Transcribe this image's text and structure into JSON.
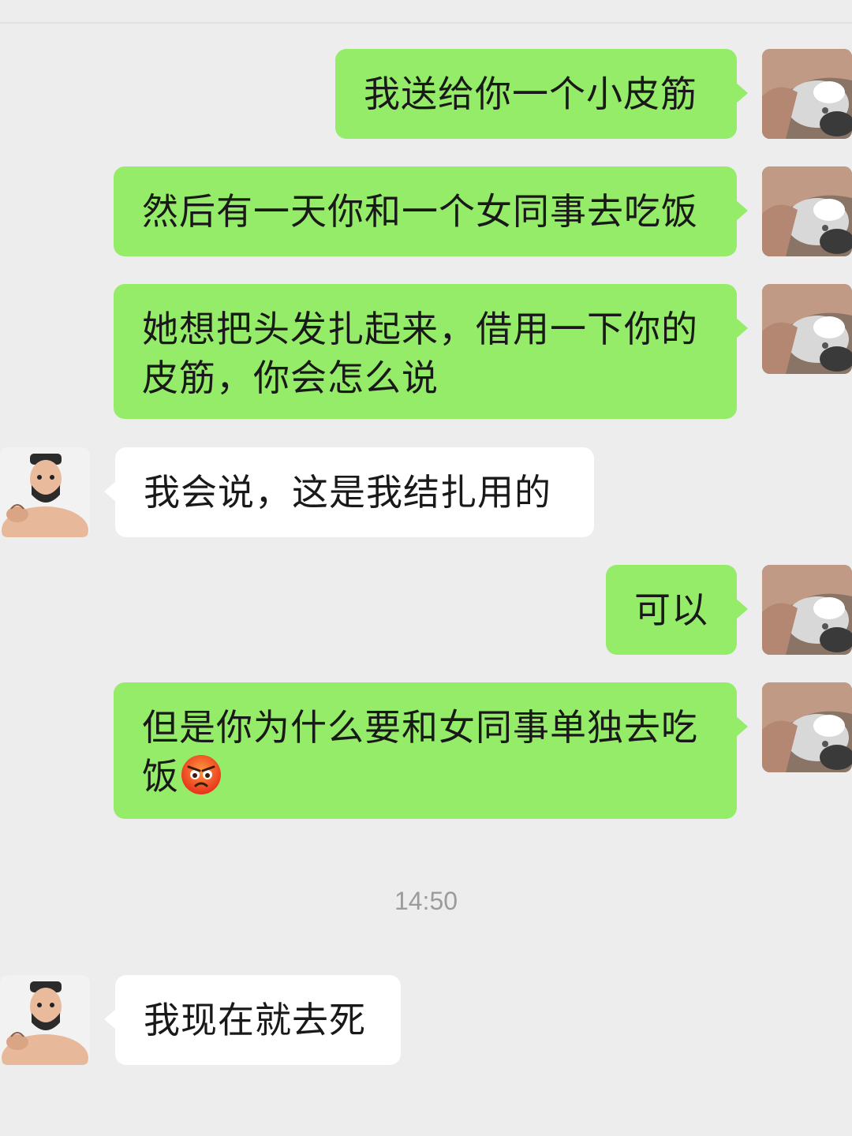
{
  "chat": {
    "messages": [
      {
        "sender": "me",
        "text": "我送给你一个小皮筋",
        "avatar": "cat-photo-avatar"
      },
      {
        "sender": "me",
        "text": "然后有一天你和一个女同事去吃饭",
        "avatar": "cat-photo-avatar"
      },
      {
        "sender": "me",
        "text": "她想把头发扎起来，借用一下你的皮筋，你会怎么说",
        "avatar": "cat-photo-avatar"
      },
      {
        "sender": "other",
        "text": "我会说，这是我结扎用的",
        "avatar": "cartoon-man-avatar"
      },
      {
        "sender": "me",
        "text": "可以",
        "avatar": "cat-photo-avatar"
      },
      {
        "sender": "me",
        "text": "但是你为什么要和女同事单独去吃饭",
        "emoji": "angry-face-icon",
        "avatar": "cat-photo-avatar"
      },
      {
        "sender": "other",
        "text": "我现在就去死",
        "avatar": "cartoon-man-avatar"
      }
    ],
    "timestamp": "14:50"
  },
  "colors": {
    "background": "#ededed",
    "my_bubble": "#95ec69",
    "their_bubble": "#ffffff",
    "timestamp_text": "#9b9b9b"
  }
}
